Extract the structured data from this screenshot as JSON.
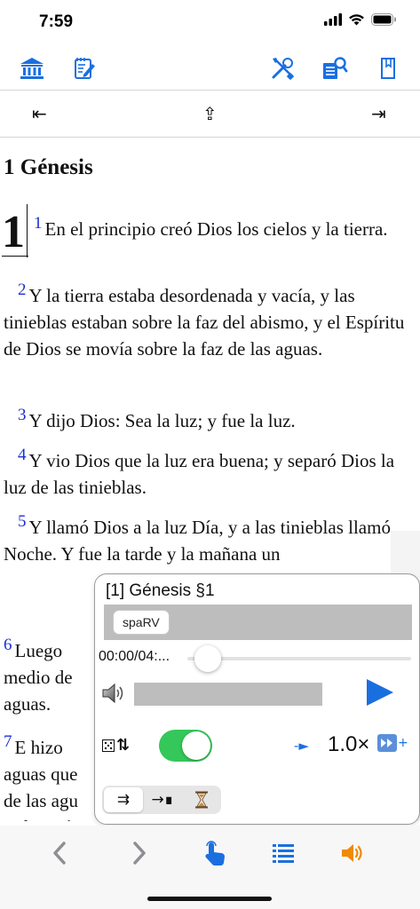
{
  "status": {
    "time": "7:59"
  },
  "toolbar": {
    "left_icons": [
      "library-icon",
      "notes-icon"
    ],
    "right_icons": [
      "tools-icon",
      "search-list-icon",
      "bookmark-icon"
    ],
    "accent": "#1a6fe0"
  },
  "nav": {
    "first": "⇤",
    "up": "⇪",
    "last": "⇥"
  },
  "chapter": {
    "title": "1 Génesis",
    "big_number": "1",
    "verses": [
      {
        "num": "1",
        "text": "En el principio creó Dios los cielos y la tierra."
      },
      {
        "num": "2",
        "text": "Y la tierra estaba desordenada y vacía, y las tinieblas estaban sobre la faz del abismo, y el Espíritu de Dios se movía sobre la faz de las aguas."
      },
      {
        "num": "3",
        "text": "Y dijo Dios: Sea la luz; y fue la luz."
      },
      {
        "num": "4",
        "text": "Y vio Dios que la luz era buena; y separó Dios la luz de las tinieblas."
      },
      {
        "num": "5",
        "text": "Y llamó Dios a la luz Día, y a las tinieblas llamó Noche. Y fue la tarde y la mañana un"
      },
      {
        "num": "6",
        "text": "Luego\nmedio de\naguas."
      },
      {
        "num": "7",
        "text": "E hizo\naguas que\nde las agu\nY fue así."
      }
    ],
    "verse_color": "#1a2fd6"
  },
  "player": {
    "title": "[1] Génesis §1",
    "version": "spaRV",
    "time": "00:00/04:...",
    "progress": 0.0,
    "play_color": "#1a6fe0",
    "toggle_on": true,
    "toggle_color": "#34c759",
    "speed": "1.0×",
    "speed_arrow": "-►",
    "mode_segments": [
      "⇉",
      "→∎",
      "⌛"
    ]
  },
  "bottom": {
    "icons": [
      "chevron-left-icon",
      "chevron-right-icon",
      "tap-icon",
      "list-icon",
      "volume-icon"
    ],
    "accent": "#1a6fe0",
    "volume_color": "#f08a00"
  }
}
